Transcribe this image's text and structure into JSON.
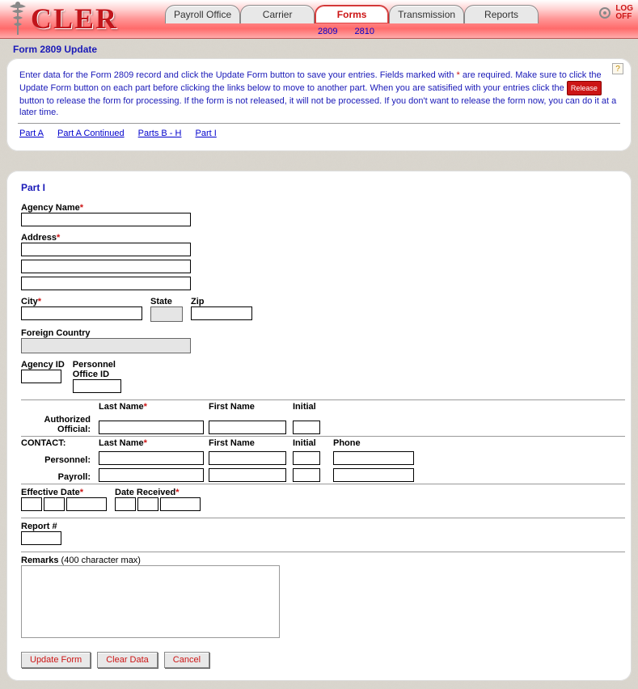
{
  "app": {
    "logo_text": "CLER"
  },
  "tabs": {
    "items": [
      {
        "label": "Payroll Office"
      },
      {
        "label": "Carrier"
      },
      {
        "label": "Forms"
      },
      {
        "label": "Transmission"
      },
      {
        "label": "Reports"
      }
    ],
    "active_index": 2,
    "sublinks": [
      "2809",
      "2810"
    ]
  },
  "logoff": {
    "line1": "LOG",
    "line2": "OFF"
  },
  "page_title": "Form 2809 Update",
  "instructions": {
    "pre": "Enter data for the Form 2809 record and click the Update Form button to save your entries.  Fields marked with ",
    "star": "*",
    "mid": " are required.  Make sure to click the Update Form button on each part before clicking the links below to move to another part.  When you are satisified with your entries click the ",
    "release": "Release",
    "post": " button to release the form for processing.  If the form is not released, it will not be processed.  If you don't want to release the form now, you can do it at a later time."
  },
  "part_links": [
    "Part A",
    "Part A Continued",
    "Parts B - H",
    "Part I"
  ],
  "section": "Part I",
  "labels": {
    "agency_name": "Agency Name",
    "address": "Address",
    "city": "City",
    "state": "State",
    "zip": "Zip",
    "foreign_country": "Foreign Country",
    "agency_id": "Agency ID",
    "personnel_office_id1": "Personnel",
    "personnel_office_id2": "Office ID",
    "authorized1": "Authorized",
    "authorized2": "Official:",
    "last_name": "Last Name",
    "first_name": "First Name",
    "initial": "Initial",
    "phone": "Phone",
    "contact": "CONTACT:",
    "personnel": "Personnel:",
    "payroll": "Payroll:",
    "effective_date": "Effective Date",
    "date_received": "Date Received",
    "report_num": "Report #",
    "remarks": "Remarks",
    "remarks_note": "(400 character max)"
  },
  "buttons": {
    "update": "Update Form",
    "clear": "Clear Data",
    "cancel": "Cancel"
  },
  "help": "?"
}
